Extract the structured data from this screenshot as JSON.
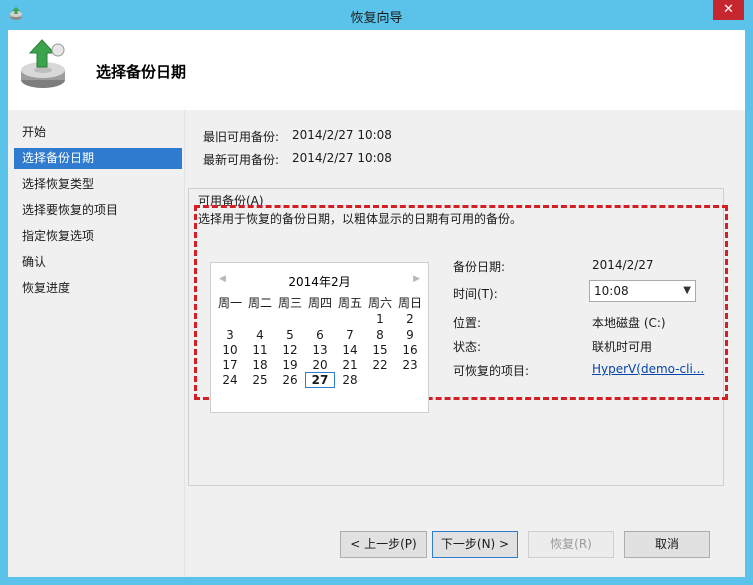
{
  "window": {
    "title": "恢复向导",
    "close_label": "✕"
  },
  "header": {
    "title": "选择备份日期"
  },
  "nav": {
    "items": [
      {
        "label": "开始"
      },
      {
        "label": "选择备份日期"
      },
      {
        "label": "选择恢复类型"
      },
      {
        "label": "选择要恢复的项目"
      },
      {
        "label": "指定恢复选项"
      },
      {
        "label": "确认"
      },
      {
        "label": "恢复进度"
      }
    ],
    "active_index": 1
  },
  "info": {
    "oldest_label": "最旧可用备份:",
    "oldest_value": "2014/2/27 10:08",
    "newest_label": "最新可用备份:",
    "newest_value": "2014/2/27 10:08"
  },
  "group": {
    "title": "可用备份(A)",
    "description": "选择用于恢复的备份日期，以粗体显示的日期有可用的备份。"
  },
  "calendar": {
    "month_label": "2014年2月",
    "prev_icon": "◀",
    "next_icon": "▶",
    "weekdays": [
      "周一",
      "周二",
      "周三",
      "周四",
      "周五",
      "周六",
      "周日"
    ],
    "weeks": [
      [
        "",
        "",
        "",
        "",
        "",
        "1",
        "2"
      ],
      [
        "3",
        "4",
        "5",
        "6",
        "7",
        "8",
        "9"
      ],
      [
        "10",
        "11",
        "12",
        "13",
        "14",
        "15",
        "16"
      ],
      [
        "17",
        "18",
        "19",
        "20",
        "21",
        "22",
        "23"
      ],
      [
        "24",
        "25",
        "26",
        "27",
        "28",
        "",
        ""
      ]
    ],
    "selected_day": "27"
  },
  "details": {
    "backup_date_label": "备份日期:",
    "backup_date_value": "2014/2/27",
    "time_label": "时间(T):",
    "time_value": "10:08",
    "location_label": "位置:",
    "location_value": "本地磁盘 (C:)",
    "status_label": "状态:",
    "status_value": "联机时可用",
    "items_label": "可恢复的项目:",
    "items_value": "HyperV(demo-cli..."
  },
  "buttons": {
    "prev": "< 上一步(P)",
    "next": "下一步(N) >",
    "recover": "恢复(R)",
    "cancel": "取消"
  },
  "colors": {
    "titlebar": "#5bc3ea",
    "active_nav": "#2f7bd0",
    "highlight": "#d21f26"
  }
}
